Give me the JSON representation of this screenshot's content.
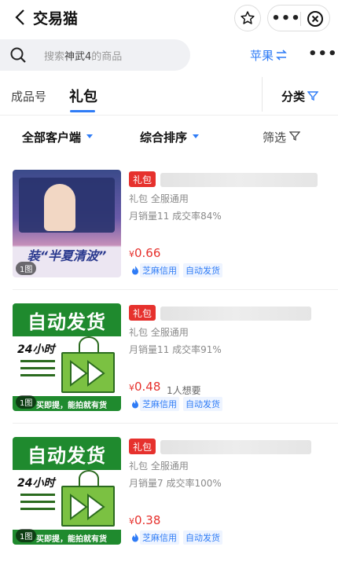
{
  "header": {
    "title": "交易猫"
  },
  "search": {
    "prefix": "搜索",
    "game": "神武4",
    "suffix": "的商品"
  },
  "platform": {
    "label": "苹果"
  },
  "tabs": {
    "finished": "成品号",
    "gift": "礼包",
    "category": "分类"
  },
  "filters": {
    "client": "全部客户端",
    "sort": "综合排序",
    "screen": "筛选"
  },
  "items": [
    {
      "tag": "礼包",
      "sub1": "礼包 全服通用",
      "sub2": "月销量11 成交率84%",
      "yen": "¥",
      "price": "0.66",
      "wants": "",
      "chip1": "芝麻信用",
      "chip2": "自动发货",
      "badge": "1图",
      "thumb_type": "game-art"
    },
    {
      "tag": "礼包",
      "sub1": "礼包 全服通用",
      "sub2": "月销量11 成交率91%",
      "yen": "¥",
      "price": "0.48",
      "wants": "1人想要",
      "chip1": "芝麻信用",
      "chip2": "自动发货",
      "badge": "1图",
      "thumb_type": "auto-delivery"
    },
    {
      "tag": "礼包",
      "sub1": "礼包 全服通用",
      "sub2": "月销量7 成交率100%",
      "yen": "¥",
      "price": "0.38",
      "wants": "",
      "chip1": "芝麻信用",
      "chip2": "自动发货",
      "badge": "1图",
      "thumb_type": "auto-delivery"
    }
  ],
  "thumb_text": {
    "ad_title": "自动发货",
    "ad_24h": "24小时",
    "ad_bottom": "买即提，能拍就有货",
    "art_caption": "装“半夏清波”"
  },
  "colors": {
    "accent": "#2f7cf6",
    "price": "#e6312d",
    "green": "#1f8a2e"
  }
}
